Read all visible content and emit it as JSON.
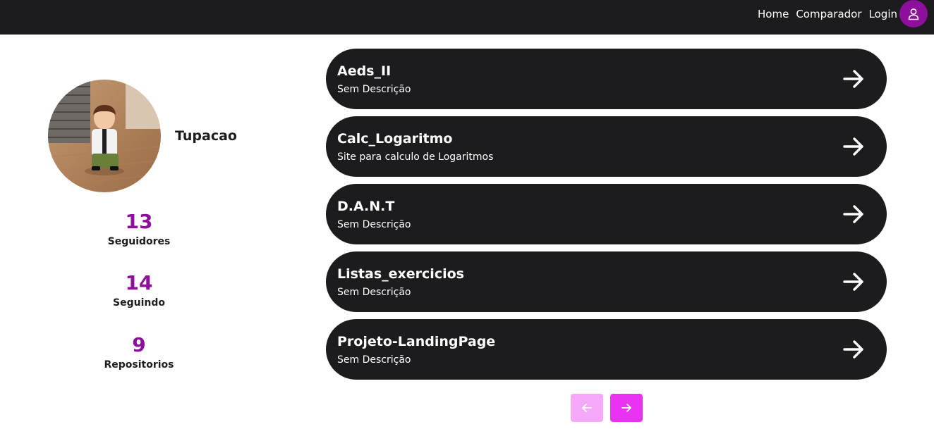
{
  "nav": {
    "home": "Home",
    "comparador": "Comparador",
    "login": "Login",
    "user_icon": "user-icon"
  },
  "profile": {
    "username": "Tupacao",
    "stats": [
      {
        "value": "13",
        "label": "Seguidores"
      },
      {
        "value": "14",
        "label": "Seguindo"
      },
      {
        "value": "9",
        "label": "Repositorios"
      }
    ]
  },
  "repos": [
    {
      "name": "Aeds_II",
      "description": "Sem Descrição"
    },
    {
      "name": "Calc_Logaritmo",
      "description": "Site para calculo de Logaritmos"
    },
    {
      "name": "D.A.N.T",
      "description": "Sem Descrição"
    },
    {
      "name": "Listas_exercicios",
      "description": "Sem Descrição"
    },
    {
      "name": "Projeto-LandingPage",
      "description": "Sem Descrição"
    }
  ],
  "pagination": {
    "prev_icon": "arrow-left-icon",
    "next_icon": "arrow-right-icon"
  },
  "colors": {
    "accent": "#8e0f9b",
    "dark": "#1c1b1d",
    "pager_prev": "#f6a8f8",
    "pager_next": "#ea33f2"
  }
}
